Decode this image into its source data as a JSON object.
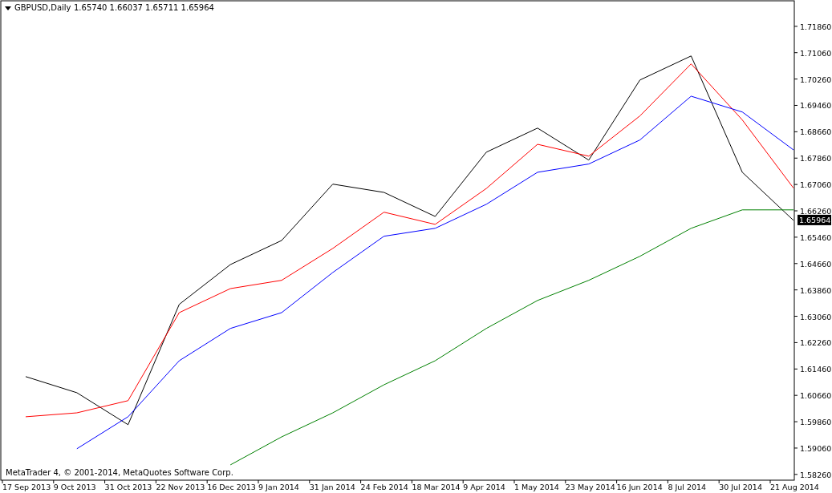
{
  "header": {
    "symbol": "GBPUSD,Daily",
    "ohlc": "1.65740 1.66037 1.65711 1.65964"
  },
  "copyright": "MetaTrader 4, © 2001-2014, MetaQuotes Software Corp.",
  "current_price": "1.65964",
  "chart_data": {
    "type": "line",
    "categories": [
      "17 Sep 2013",
      "9 Oct 2013",
      "31 Oct 2013",
      "22 Nov 2013",
      "16 Dec 2013",
      "9 Jan 2014",
      "31 Jan 2014",
      "24 Feb 2014",
      "18 Mar 2014",
      "9 Apr 2014",
      "1 May 2014",
      "23 May 2014",
      "16 Jun 2014",
      "8 Jul 2014",
      "30 Jul 2014",
      "21 Aug 2014"
    ],
    "ylim": [
      1.5811,
      1.7261
    ],
    "yticks": [
      {
        "value": 1.5826,
        "label": "1.58260"
      },
      {
        "value": 1.5906,
        "label": "1.59060"
      },
      {
        "value": 1.5986,
        "label": "1.59860"
      },
      {
        "value": 1.6066,
        "label": "1.60660"
      },
      {
        "value": 1.6146,
        "label": "1.61460"
      },
      {
        "value": 1.6226,
        "label": "1.62260"
      },
      {
        "value": 1.6306,
        "label": "1.63060"
      },
      {
        "value": 1.6386,
        "label": "1.63860"
      },
      {
        "value": 1.6466,
        "label": "1.64660"
      },
      {
        "value": 1.6546,
        "label": "1.65460"
      },
      {
        "value": 1.6626,
        "label": "1.66260"
      },
      {
        "value": 1.6706,
        "label": "1.67060"
      },
      {
        "value": 1.6786,
        "label": "1.67860"
      },
      {
        "value": 1.6866,
        "label": "1.68660"
      },
      {
        "value": 1.6946,
        "label": "1.69460"
      },
      {
        "value": 1.7026,
        "label": "1.70260"
      },
      {
        "value": 1.7106,
        "label": "1.71060"
      },
      {
        "value": 1.7186,
        "label": "1.71860"
      }
    ],
    "series": [
      {
        "color": "#000000",
        "values": [
          1.6123,
          1.6074,
          1.5977,
          1.6342,
          1.6463,
          1.6536,
          1.6707,
          1.6682,
          1.6609,
          1.6804,
          1.6877,
          1.678,
          1.7023,
          1.7096,
          1.6743,
          1.6597
        ]
      },
      {
        "color": "#ff0000",
        "values": [
          1.6001,
          1.6013,
          1.605,
          1.6317,
          1.639,
          1.6415,
          1.6512,
          1.6622,
          1.6585,
          1.6694,
          1.6828,
          1.6792,
          1.6914,
          1.7072,
          1.6902,
          1.6695
        ]
      },
      {
        "color": "#0000ff",
        "values": [
          null,
          1.5904,
          1.6001,
          1.6171,
          1.6269,
          1.6317,
          1.6439,
          1.6549,
          1.6573,
          1.6646,
          1.6743,
          1.6768,
          1.6841,
          1.6974,
          1.6926,
          1.6811
        ]
      },
      {
        "color": "#008000",
        "values": [
          null,
          null,
          null,
          null,
          1.5855,
          1.594,
          1.6013,
          1.6098,
          1.6171,
          1.6269,
          1.6354,
          1.6415,
          1.6488,
          1.6573,
          1.6629,
          1.6629
        ]
      }
    ]
  }
}
